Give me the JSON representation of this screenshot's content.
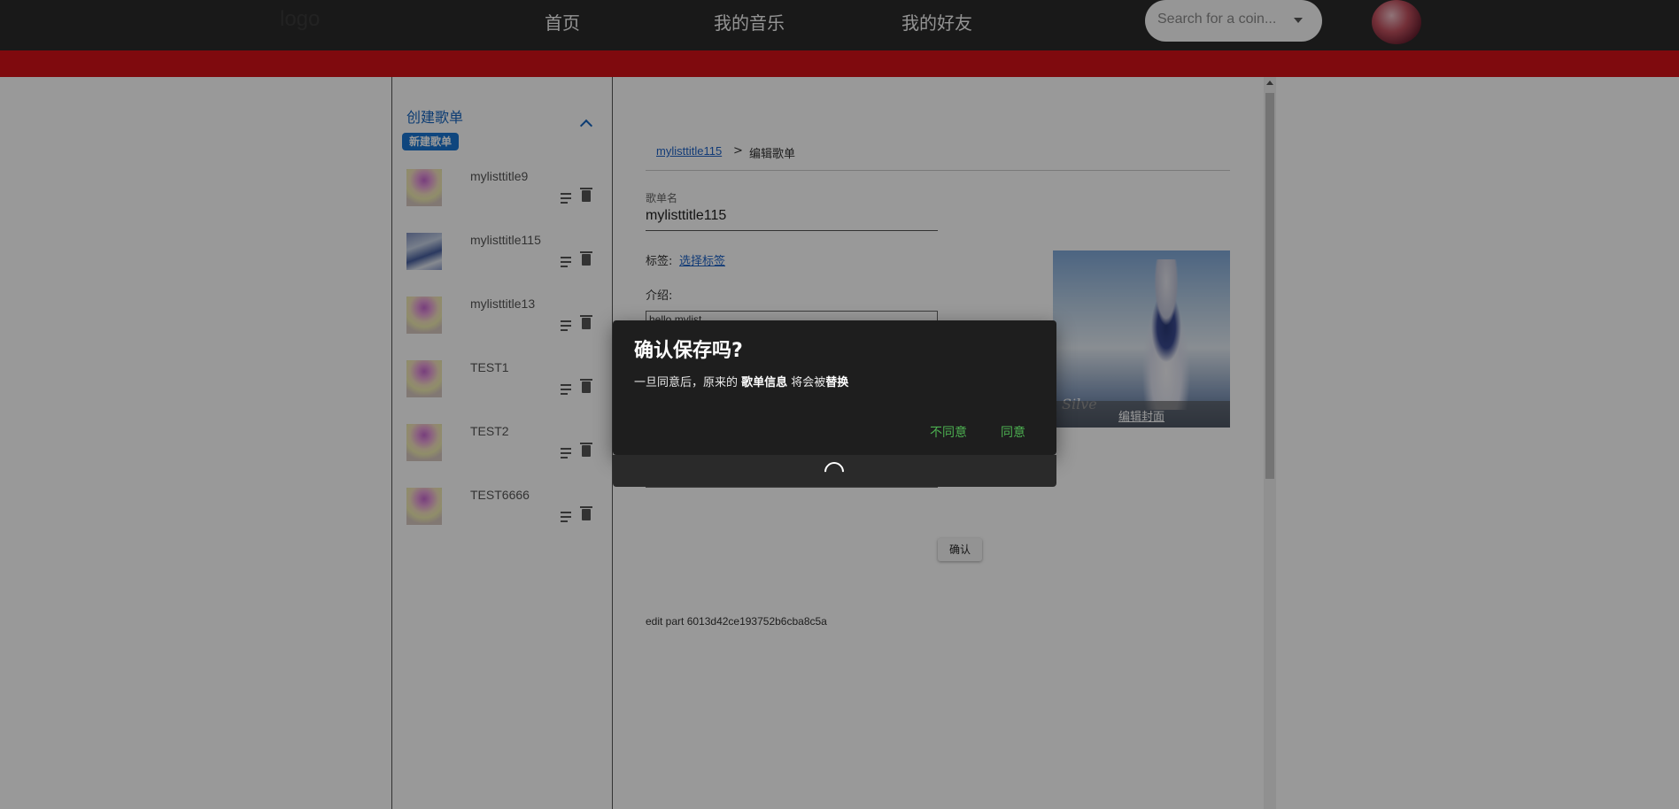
{
  "header": {
    "logo": "logo",
    "nav": [
      "首页",
      "我的音乐",
      "我的好友"
    ],
    "search_placeholder": "Search for a coin..."
  },
  "sidebar": {
    "title": "创建歌单",
    "new_button": "新建歌单",
    "playlists": [
      {
        "name": "mylisttitle9"
      },
      {
        "name": "mylisttitle115"
      },
      {
        "name": "mylisttitle13"
      },
      {
        "name": "TEST1"
      },
      {
        "name": "TEST2"
      },
      {
        "name": "TEST6666"
      }
    ]
  },
  "main": {
    "breadcrumb": {
      "link": "mylisttitle115",
      "separator": ">",
      "current": "编辑歌单"
    },
    "name_label": "歌单名",
    "name_value": "mylisttitle115",
    "tag_label": "标签:",
    "tag_link": "选择标签",
    "intro_label": "介绍:",
    "intro_value": "hello mylist",
    "cover_button": "编辑封面",
    "cover_script": "Silve",
    "confirm_button": "确认",
    "edit_part": "edit part 6013d42ce193752b6cba8c5a"
  },
  "dialog": {
    "title": "确认保存吗?",
    "body_prefix": "一旦同意后，原来的 ",
    "body_bold1": "歌单信息",
    "body_mid": " 将会被",
    "body_bold2": "替换",
    "disagree": "不同意",
    "agree": "同意"
  },
  "colors": {
    "header_bg": "#2b2b2b",
    "accent_red": "#d41218",
    "link_blue": "#1e63c7",
    "button_green": "#4caf50",
    "dialog_bg": "#1e1e1e"
  }
}
